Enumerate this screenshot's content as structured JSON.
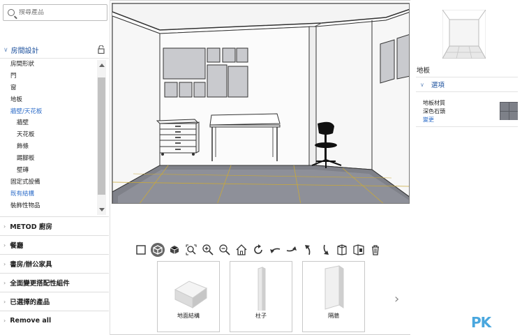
{
  "search": {
    "placeholder": "搜尋產品"
  },
  "section": {
    "title": "房間設計"
  },
  "tree": [
    {
      "label": "房間形狀",
      "level": 1
    },
    {
      "label": "門",
      "level": 1
    },
    {
      "label": "窗",
      "level": 1
    },
    {
      "label": "地板",
      "level": 1
    },
    {
      "label": "牆壁/天花板",
      "level": 1,
      "active": true
    },
    {
      "label": "牆壁",
      "level": 2
    },
    {
      "label": "天花板",
      "level": 2
    },
    {
      "label": "飾條",
      "level": 2
    },
    {
      "label": "踢腳板",
      "level": 2
    },
    {
      "label": "壁磚",
      "level": 2
    },
    {
      "label": "固定式設備",
      "level": 1
    },
    {
      "label": "既有結構",
      "level": 1,
      "link": true
    },
    {
      "label": "裝飾性物品",
      "level": 1
    }
  ],
  "categories": [
    "METOD 廚房",
    "餐廳",
    "書房/辦公家具",
    "全面變更搭配性組件",
    "已選擇的產品",
    "Remove all"
  ],
  "toolbar_icons": [
    "2d-view-icon",
    "3d-view-icon",
    "box-view-icon",
    "zoom-fit-icon",
    "zoom-in-icon",
    "zoom-out-icon",
    "home-view-icon",
    "rotate-left-icon",
    "turn-left-icon",
    "turn-right-icon",
    "tilt-up-icon",
    "tilt-down-icon",
    "wall-toggle-icon",
    "wall-view-icon",
    "delete-icon"
  ],
  "cards": [
    {
      "label": "地面結構"
    },
    {
      "label": "柱子"
    },
    {
      "label": "隔牆"
    }
  ],
  "right_panel": {
    "title": "地板",
    "options_label": "選項",
    "material_label": "地板材質",
    "material_name": "深色石頭",
    "change_link": "變更"
  },
  "watermark": {
    "logo": "PK",
    "sub": ""
  }
}
